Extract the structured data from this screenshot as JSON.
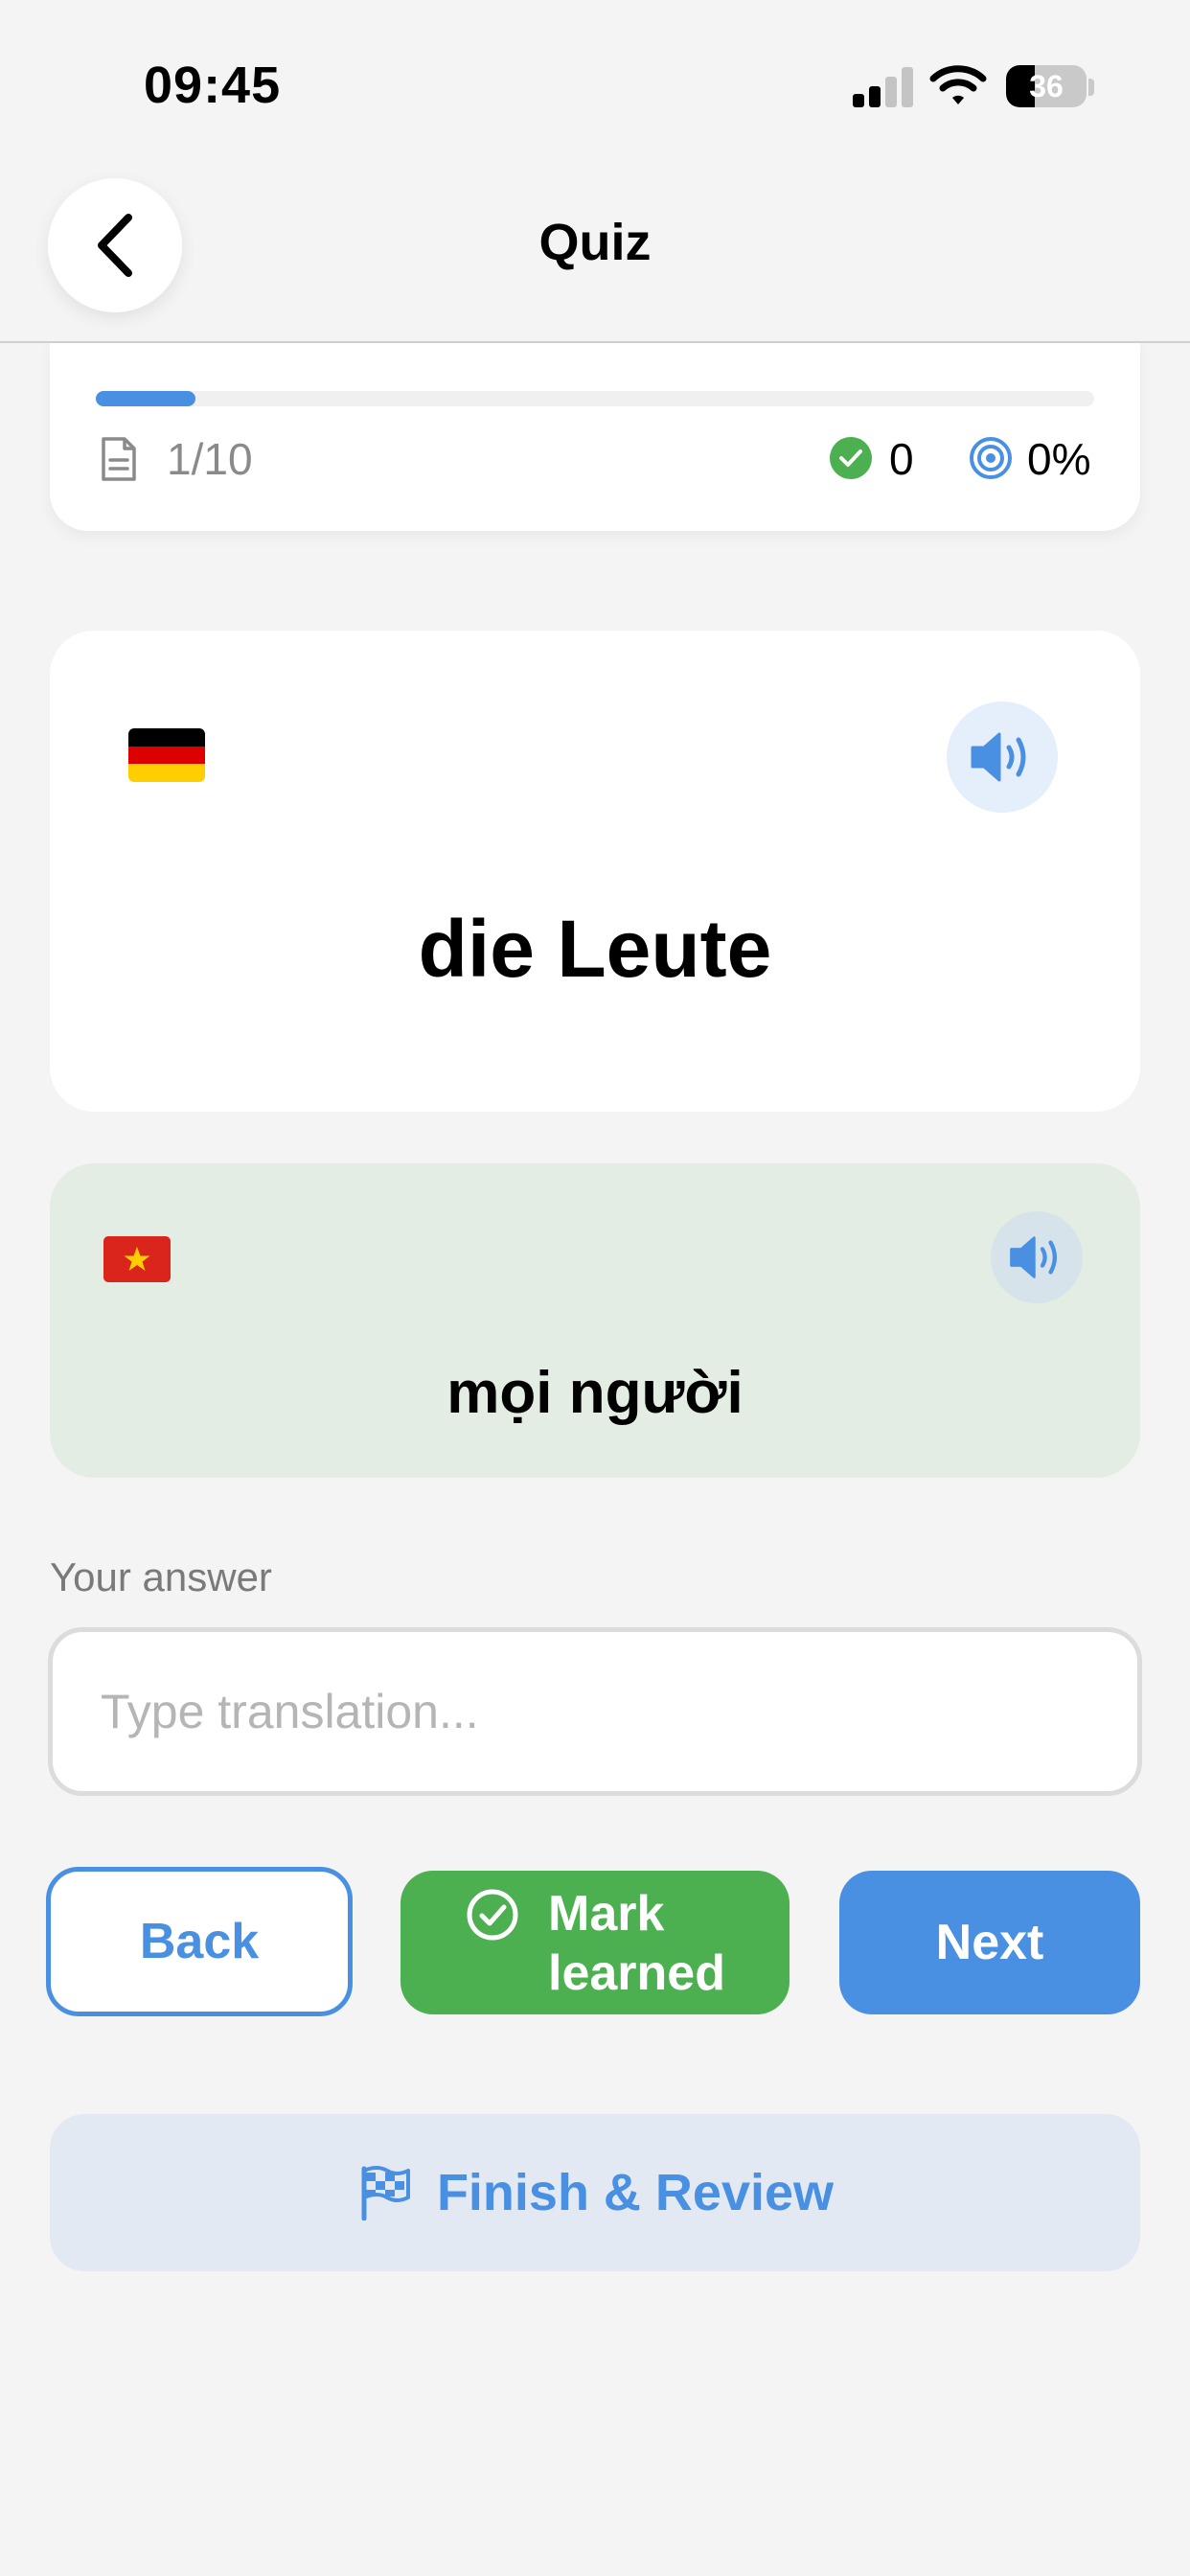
{
  "status_bar": {
    "time": "09:45",
    "battery": "36",
    "battery_level": 0.36,
    "signal_bars": 2
  },
  "nav": {
    "title": "Quiz",
    "back_icon": "chevron-left-icon"
  },
  "progress": {
    "count": "1/10",
    "fraction": 0.1,
    "correct": "0",
    "accuracy": "0%"
  },
  "card": {
    "source_flag": "germany-flag",
    "word": "die Leute"
  },
  "translation": {
    "target_flag": "vietnam-flag",
    "text": "mọi người"
  },
  "answer": {
    "label": "Your answer",
    "placeholder": "Type translation...",
    "value": ""
  },
  "buttons": {
    "back": "Back",
    "mark_learned": "Mark learned",
    "next": "Next",
    "finish": "Finish & Review"
  },
  "colors": {
    "accent": "#4a90e2",
    "success": "#4caf50",
    "translation_bg": "#e4ede3"
  }
}
